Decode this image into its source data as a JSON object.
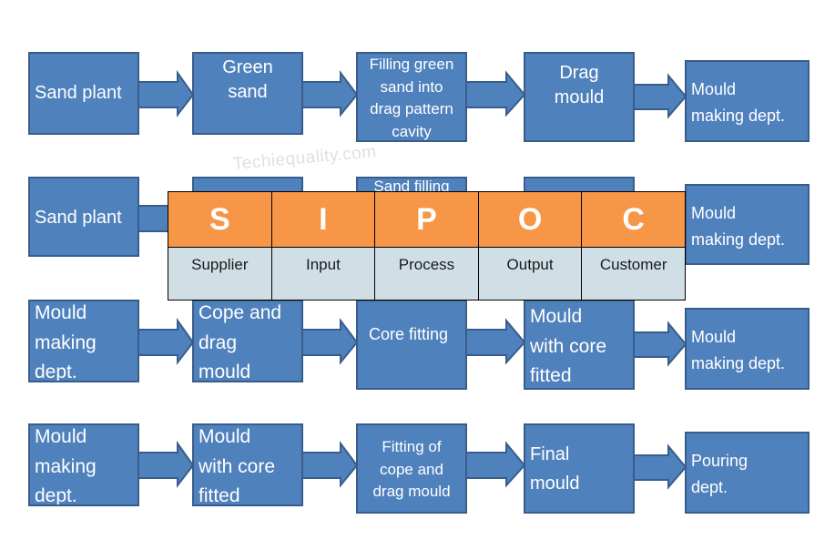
{
  "diagram": {
    "watermark": "Techiequality.com",
    "colors": {
      "box_fill": "#4f81bd",
      "box_border": "#385d8a",
      "sipoc_header": "#f79646",
      "sipoc_body": "#d0dfe6"
    },
    "rows": [
      {
        "steps": [
          "Sand plant",
          "Green\nsand",
          "Filling green\nsand into\ndrag pattern\ncavity",
          "Drag\nmould",
          "Mould\nmaking dept."
        ]
      },
      {
        "steps": [
          "Sand plant",
          "",
          "Sand filling",
          "",
          "Mould\nmaking dept."
        ]
      },
      {
        "steps": [
          "Mould\nmaking\ndept.",
          "Cope and\ndrag\nmould",
          "Core fitting",
          "Mould\nwith core\nfitted",
          "Mould\nmaking dept."
        ]
      },
      {
        "steps": [
          "Mould\nmaking\ndept.",
          "Mould\nwith core\nfitted",
          "Fitting of\ncope and\ndrag mould",
          "Final\nmould",
          "Pouring\ndept."
        ]
      }
    ],
    "sipoc": {
      "columns": [
        {
          "letter": "S",
          "word": "Supplier"
        },
        {
          "letter": "I",
          "word": "Input"
        },
        {
          "letter": "P",
          "word": "Process"
        },
        {
          "letter": "O",
          "word": "Output"
        },
        {
          "letter": "C",
          "word": "Customer"
        }
      ]
    }
  }
}
